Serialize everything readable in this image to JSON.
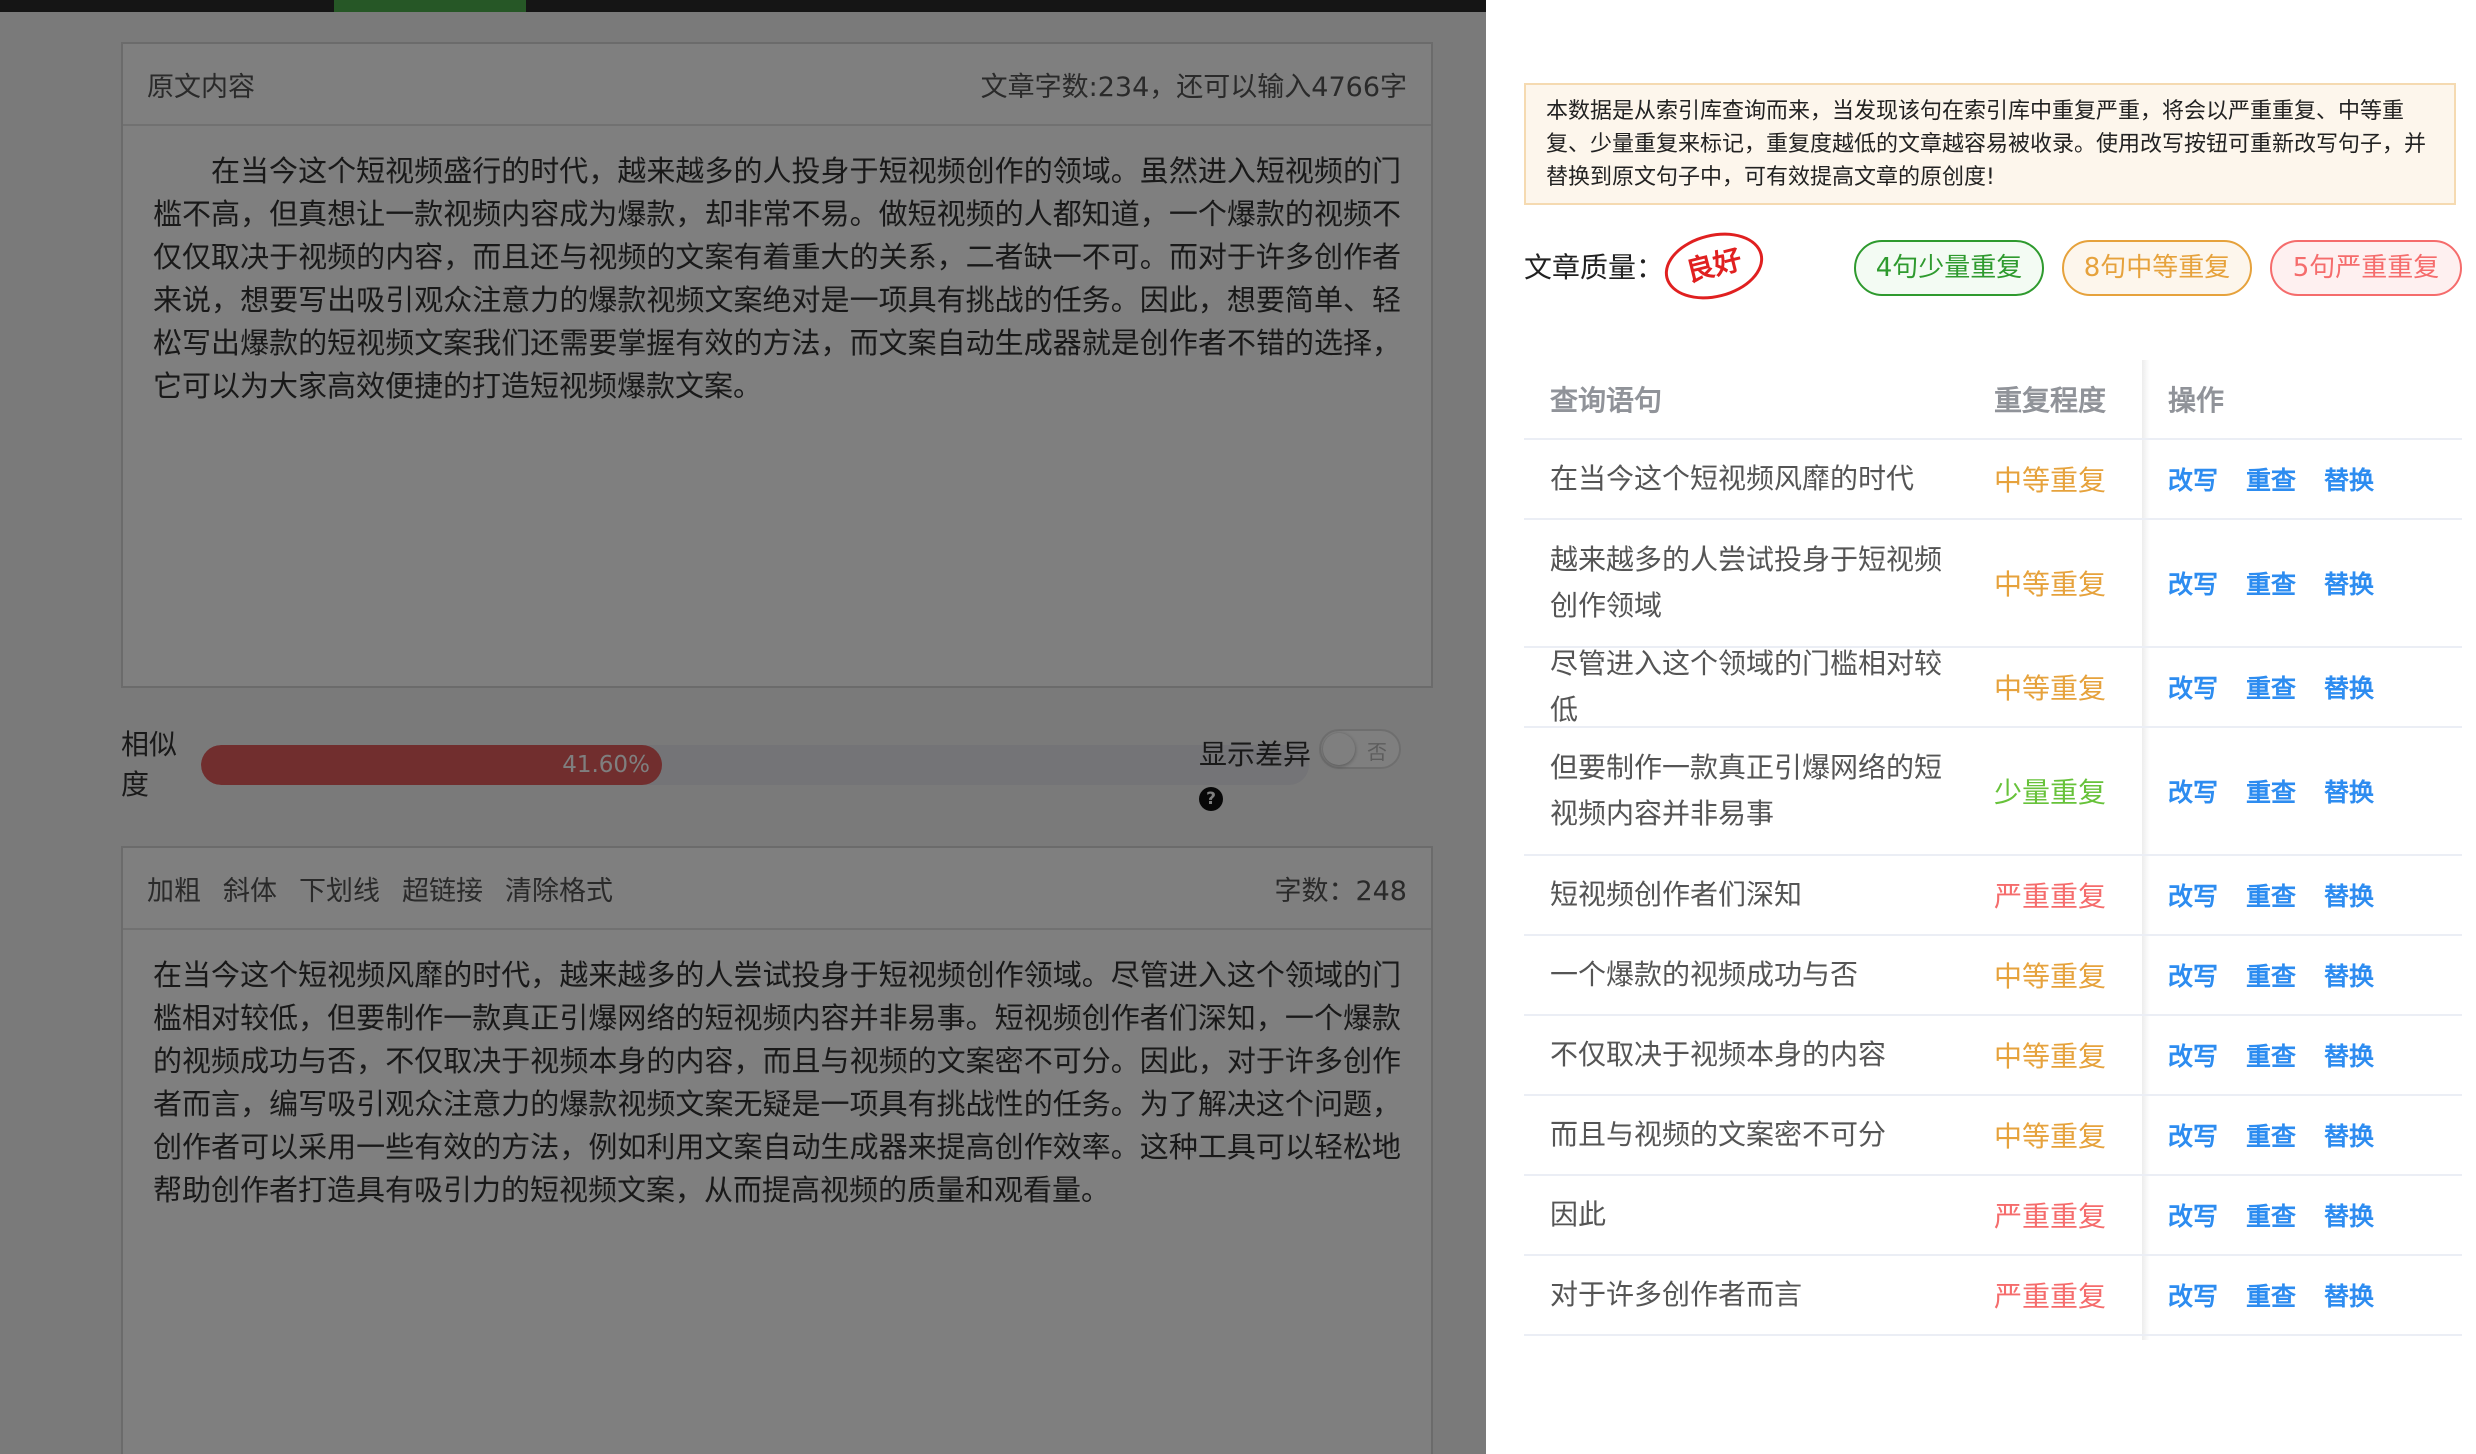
{
  "original": {
    "title": "原文内容",
    "stats": "文章字数:234，还可以输入4766字",
    "text": "在当今这个短视频盛行的时代，越来越多的人投身于短视频创作的领域。虽然进入短视频的门槛不高，但真想让一款视频内容成为爆款，却非常不易。做短视频的人都知道，一个爆款的视频不仅仅取决于视频的内容，而且还与视频的文案有着重大的关系，二者缺一不可。而对于许多创作者来说，想要写出吸引观众注意力的爆款视频文案绝对是一项具有挑战的任务。因此，想要简单、轻松写出爆款的短视频文案我们还需要掌握有效的方法，而文案自动生成器就是创作者不错的选择，它可以为大家高效便捷的打造短视频爆款文案。"
  },
  "similarity": {
    "label": "相似度",
    "value_text": "41.60%",
    "value": 41.6,
    "diff_label": "显示差异",
    "toggle_off": "否",
    "help_icon": "question-circle-icon"
  },
  "editor": {
    "tools": [
      "加粗",
      "斜体",
      "下划线",
      "超链接",
      "清除格式"
    ],
    "count": "字数：248",
    "text": "在当今这个短视频风靡的时代，越来越多的人尝试投身于短视频创作领域。尽管进入这个领域的门槛相对较低，但要制作一款真正引爆网络的短视频内容并非易事。短视频创作者们深知，一个爆款的视频成功与否，不仅取决于视频本身的内容，而且与视频的文案密不可分。因此，对于许多创作者而言，编写吸引观众注意力的爆款视频文案无疑是一项具有挑战性的任务。为了解决这个问题，创作者可以采用一些有效的方法，例如利用文案自动生成器来提高创作效率。这种工具可以轻松地帮助创作者打造具有吸引力的短视频文案，从而提高视频的质量和观看量。"
  },
  "drawer": {
    "notice": "本数据是从索引库查询而来，当发现该句在索引库中重复严重，将会以严重重复、中等重复、少量重复来标记，重复度越低的文章越容易被收录。使用改写按钮可重新改写句子，并替换到原文句子中，可有效提高文章的原创度!",
    "quality_label": "文章质量：",
    "quality_value": "良好",
    "pill_low": "4句少量重复",
    "pill_mid": "8句中等重复",
    "pill_high": "5句严重重复",
    "table": {
      "headers": [
        "查询语句",
        "重复程度",
        "操作"
      ],
      "ops": [
        "改写",
        "重查",
        "替换"
      ],
      "rows": [
        {
          "sentence": "在当今这个短视频风靡的时代",
          "level": "中等重复"
        },
        {
          "sentence": "越来越多的人尝试投身于短视频创作领域",
          "level": "中等重复"
        },
        {
          "sentence": "尽管进入这个领域的门槛相对较低",
          "level": "中等重复"
        },
        {
          "sentence": "但要制作一款真正引爆网络的短视频内容并非易事",
          "level": "少量重复"
        },
        {
          "sentence": "短视频创作者们深知",
          "level": "严重重复"
        },
        {
          "sentence": "一个爆款的视频成功与否",
          "level": "中等重复"
        },
        {
          "sentence": "不仅取决于视频本身的内容",
          "level": "中等重复"
        },
        {
          "sentence": "而且与视频的文案密不可分",
          "level": "中等重复"
        },
        {
          "sentence": "因此",
          "level": "严重重复"
        },
        {
          "sentence": "对于许多创作者而言",
          "level": "严重重复"
        }
      ]
    }
  },
  "colors": {
    "level_mid": "#e6a23c",
    "level_low": "#67c23a",
    "level_high": "#f56c6c",
    "op_link": "#2d8cf0",
    "similarity_fill": "#e35d5d"
  }
}
